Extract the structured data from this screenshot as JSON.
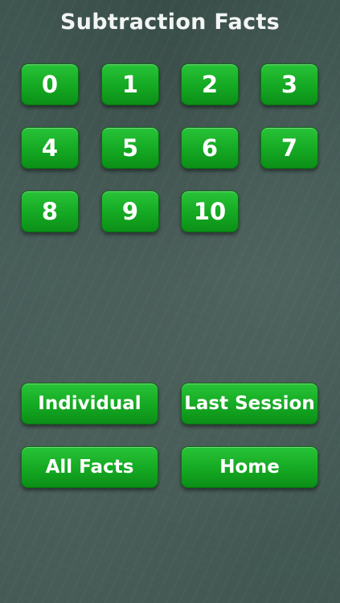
{
  "header": {
    "title": "Subtraction Facts"
  },
  "numbers": [
    "0",
    "1",
    "2",
    "3",
    "4",
    "5",
    "6",
    "7",
    "8",
    "9",
    "10"
  ],
  "actions": {
    "individual": "Individual",
    "last_session": "Last Session",
    "all_facts": "All Facts",
    "home": "Home"
  },
  "colors": {
    "background": "#435853",
    "button_green": "#16ab24",
    "text": "#ffffff"
  }
}
